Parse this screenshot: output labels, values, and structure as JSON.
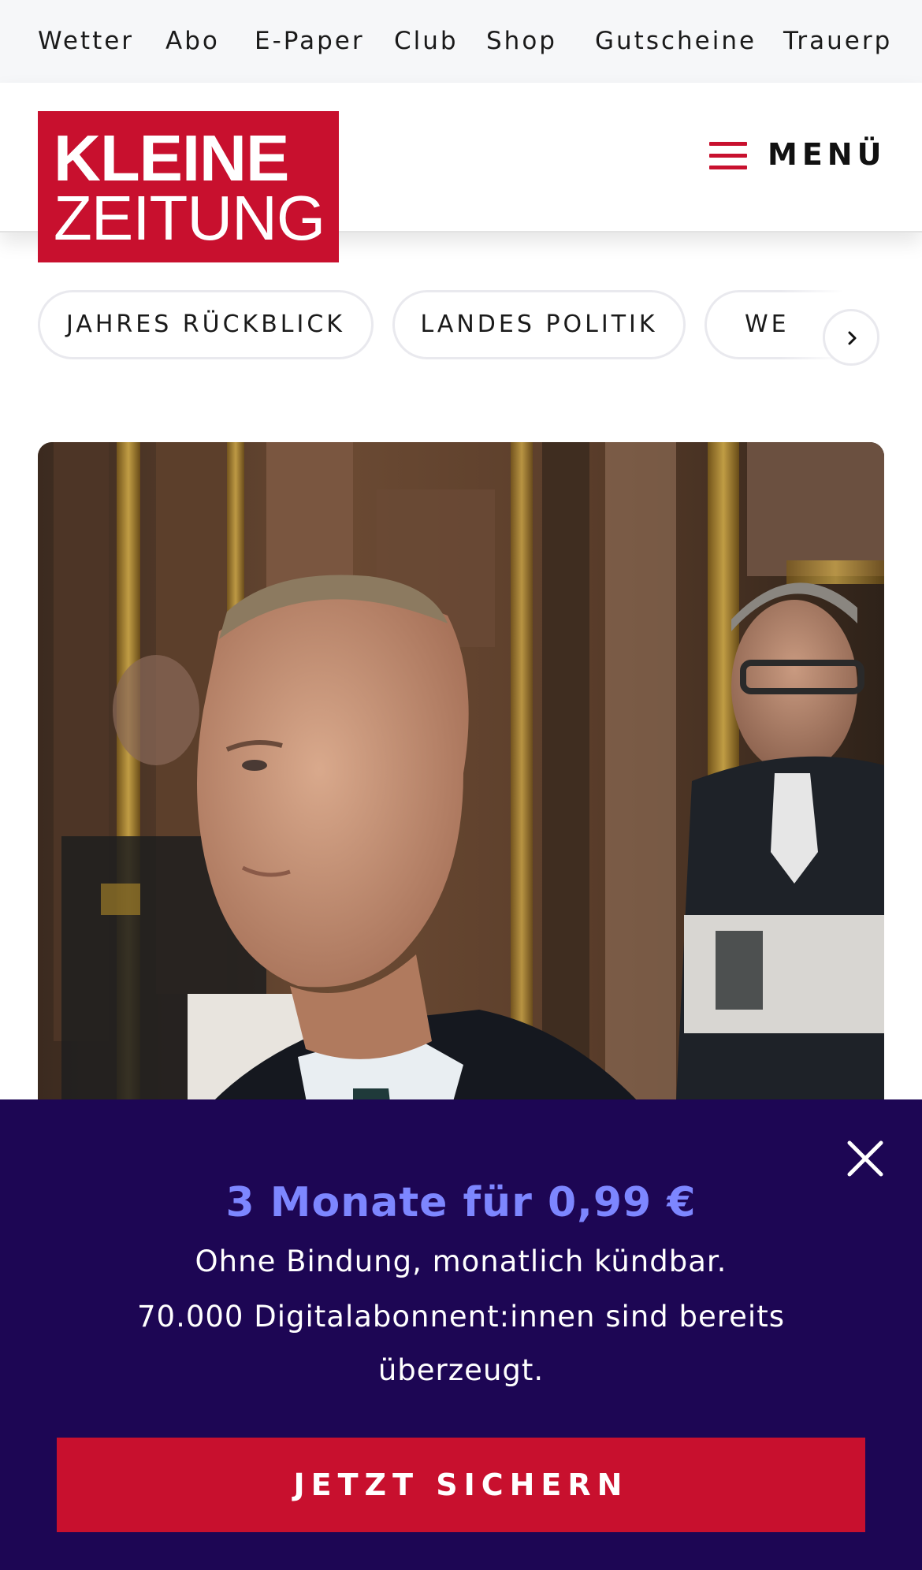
{
  "topnav": {
    "items": [
      {
        "label": "Wetter"
      },
      {
        "label": "Abo"
      },
      {
        "label": "E-Paper"
      },
      {
        "label": "Club"
      },
      {
        "label": "Shop"
      },
      {
        "label": "Gutscheine"
      },
      {
        "label": "Trauerp"
      }
    ]
  },
  "header": {
    "logo_line1": "KLEINE",
    "logo_line2": "ZEITUNG",
    "menu_label": "MENÜ"
  },
  "topics": {
    "items": [
      {
        "label": "JAHRES RÜCKBLICK"
      },
      {
        "label": "LANDES POLITIK"
      },
      {
        "label": "WE"
      }
    ]
  },
  "promo": {
    "title": "3 Monate für 0,99 €",
    "line1": "Ohne Bindung, monatlich kündbar.",
    "line2": "70.000 Digitalabonnent:innen sind bereits",
    "line3": "überzeugt.",
    "cta_label": "JETZT SICHERN"
  },
  "colors": {
    "brand_red": "#c8102e",
    "promo_bg": "#1d0654",
    "promo_title": "#7d86ff"
  },
  "icons": {
    "menu": "hamburger-icon",
    "scroll": "chevron-right-icon",
    "close": "close-icon"
  }
}
